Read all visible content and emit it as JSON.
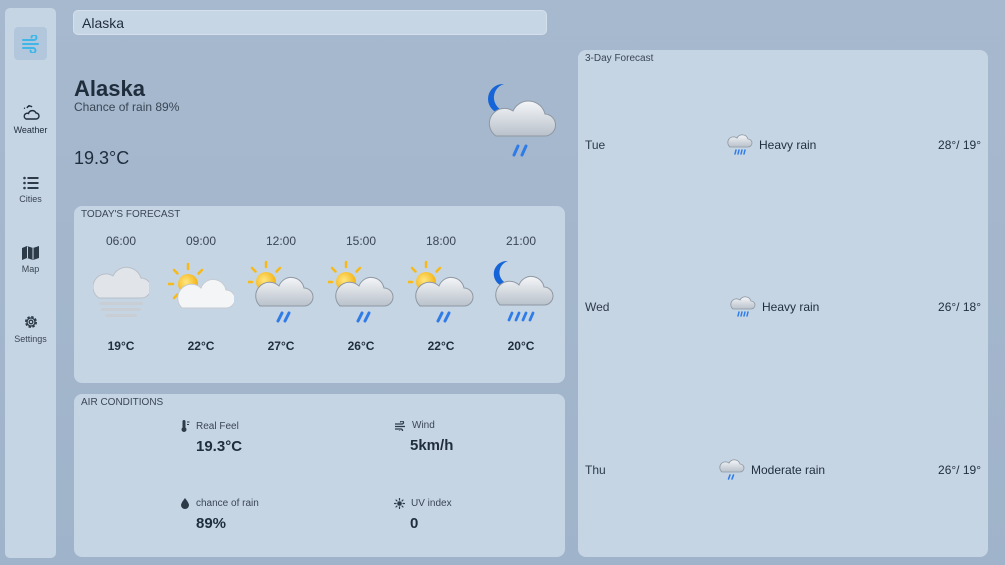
{
  "search": {
    "value": "Alaska"
  },
  "sidebar": {
    "items": [
      {
        "label": "Weather"
      },
      {
        "label": "Cities"
      },
      {
        "label": "Map"
      },
      {
        "label": "Settings"
      }
    ]
  },
  "current": {
    "city": "Alaska",
    "chance_of_rain": "Chance of rain 89%",
    "temperature": "19.3°C",
    "icon": "moon-cloud-rain-icon"
  },
  "today": {
    "title": "TODAY'S FORECAST",
    "hours": [
      {
        "time": "06:00",
        "temp": "19°C",
        "icon": "fog-icon"
      },
      {
        "time": "09:00",
        "temp": "22°C",
        "icon": "sun-cloud-icon"
      },
      {
        "time": "12:00",
        "temp": "27°C",
        "icon": "sun-cloud-rain-icon"
      },
      {
        "time": "15:00",
        "temp": "26°C",
        "icon": "sun-cloud-rain-icon"
      },
      {
        "time": "18:00",
        "temp": "22°C",
        "icon": "sun-cloud-rain-icon"
      },
      {
        "time": "21:00",
        "temp": "20°C",
        "icon": "moon-cloud-heavy-rain-icon"
      }
    ]
  },
  "air": {
    "title": "AIR CONDITIONS",
    "real_feel_label": "Real Feel",
    "real_feel": "19.3°C",
    "wind_label": "Wind",
    "wind": "5km/h",
    "rain_label": "chance of rain",
    "rain": "89%",
    "uv_label": "UV index",
    "uv": "0"
  },
  "forecast": {
    "title": "3-Day Forecast",
    "days": [
      {
        "day": "Tue",
        "desc": "Heavy rain",
        "hi": "28°",
        "lo": "/ 19°"
      },
      {
        "day": "Wed",
        "desc": "Heavy rain",
        "hi": "26°",
        "lo": "/ 18°"
      },
      {
        "day": "Thu",
        "desc": "Moderate rain",
        "hi": "26°",
        "lo": "/ 19°"
      }
    ]
  },
  "colors": {
    "sun": "#f6c320",
    "moon": "#1565d8",
    "rain": "#2f7ce8",
    "cloud": "#d7dde4",
    "accent": "#3fb6e8"
  }
}
